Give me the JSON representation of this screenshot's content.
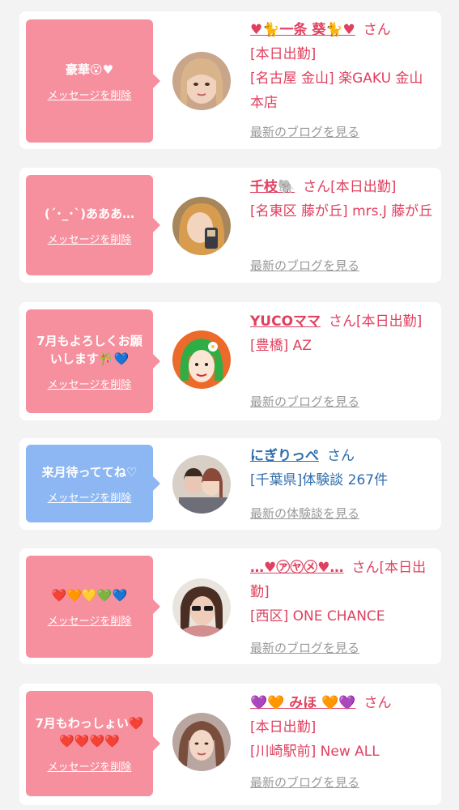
{
  "delete_label": "メッセージを削除",
  "san": "さん",
  "colors": {
    "pink": "#f7909e",
    "blue": "#8db7f2",
    "name_pink": "#e0405f",
    "name_blue": "#2f6cab",
    "link_gray": "#9a9a9a"
  },
  "cards": [
    {
      "message": "豪華😮♥",
      "bubble_color": "pink",
      "avatar": "avatar-blonde-woman",
      "name": "♥🐈一条 葵🐈♥",
      "line1": "[本日出勤]",
      "line2": "[名古屋 金山] 楽GAKU 金山本店",
      "link": "最新のブログを見る"
    },
    {
      "message": "(´･_･`)あああ…",
      "bubble_color": "pink",
      "avatar": "avatar-woman-with-phone",
      "name": "千枝🐘",
      "line1": "[本日出勤]",
      "line2": "[名東区 藤が丘] mrs.J 藤が丘",
      "link": "最新のブログを見る"
    },
    {
      "message": "7月もよろしくお願いします🎋💙",
      "bubble_color": "pink",
      "avatar": "avatar-cartoon-green-hair",
      "name": "YUCOママ",
      "line1": "[本日出勤]",
      "line2": "[豊橋] AZ",
      "link": "最新のブログを見る"
    },
    {
      "message": "来月待っててね♡",
      "bubble_color": "blue",
      "avatar": "avatar-couple",
      "name": "にぎりっぺ",
      "line1": "",
      "line2": "[千葉県]体験談 267件",
      "link": "最新の体験談を見る"
    },
    {
      "message": "❤️🧡💛💚💙",
      "bubble_color": "pink",
      "avatar": "avatar-woman-sunglasses",
      "name": "…♥㋐㋳㋱♥…",
      "line1": "[本日出勤]",
      "line2": "[西区] ONE CHANCE",
      "link": "最新のブログを見る"
    },
    {
      "message": "7月もわっしょい❤️❤️❤️❤️❤️",
      "bubble_color": "pink",
      "avatar": "avatar-woman-long-hair",
      "name": "💜🧡 みほ 🧡💜",
      "line1": "[本日出勤]",
      "line2": "[川崎駅前] New ALL",
      "link": "最新のブログを見る"
    }
  ]
}
